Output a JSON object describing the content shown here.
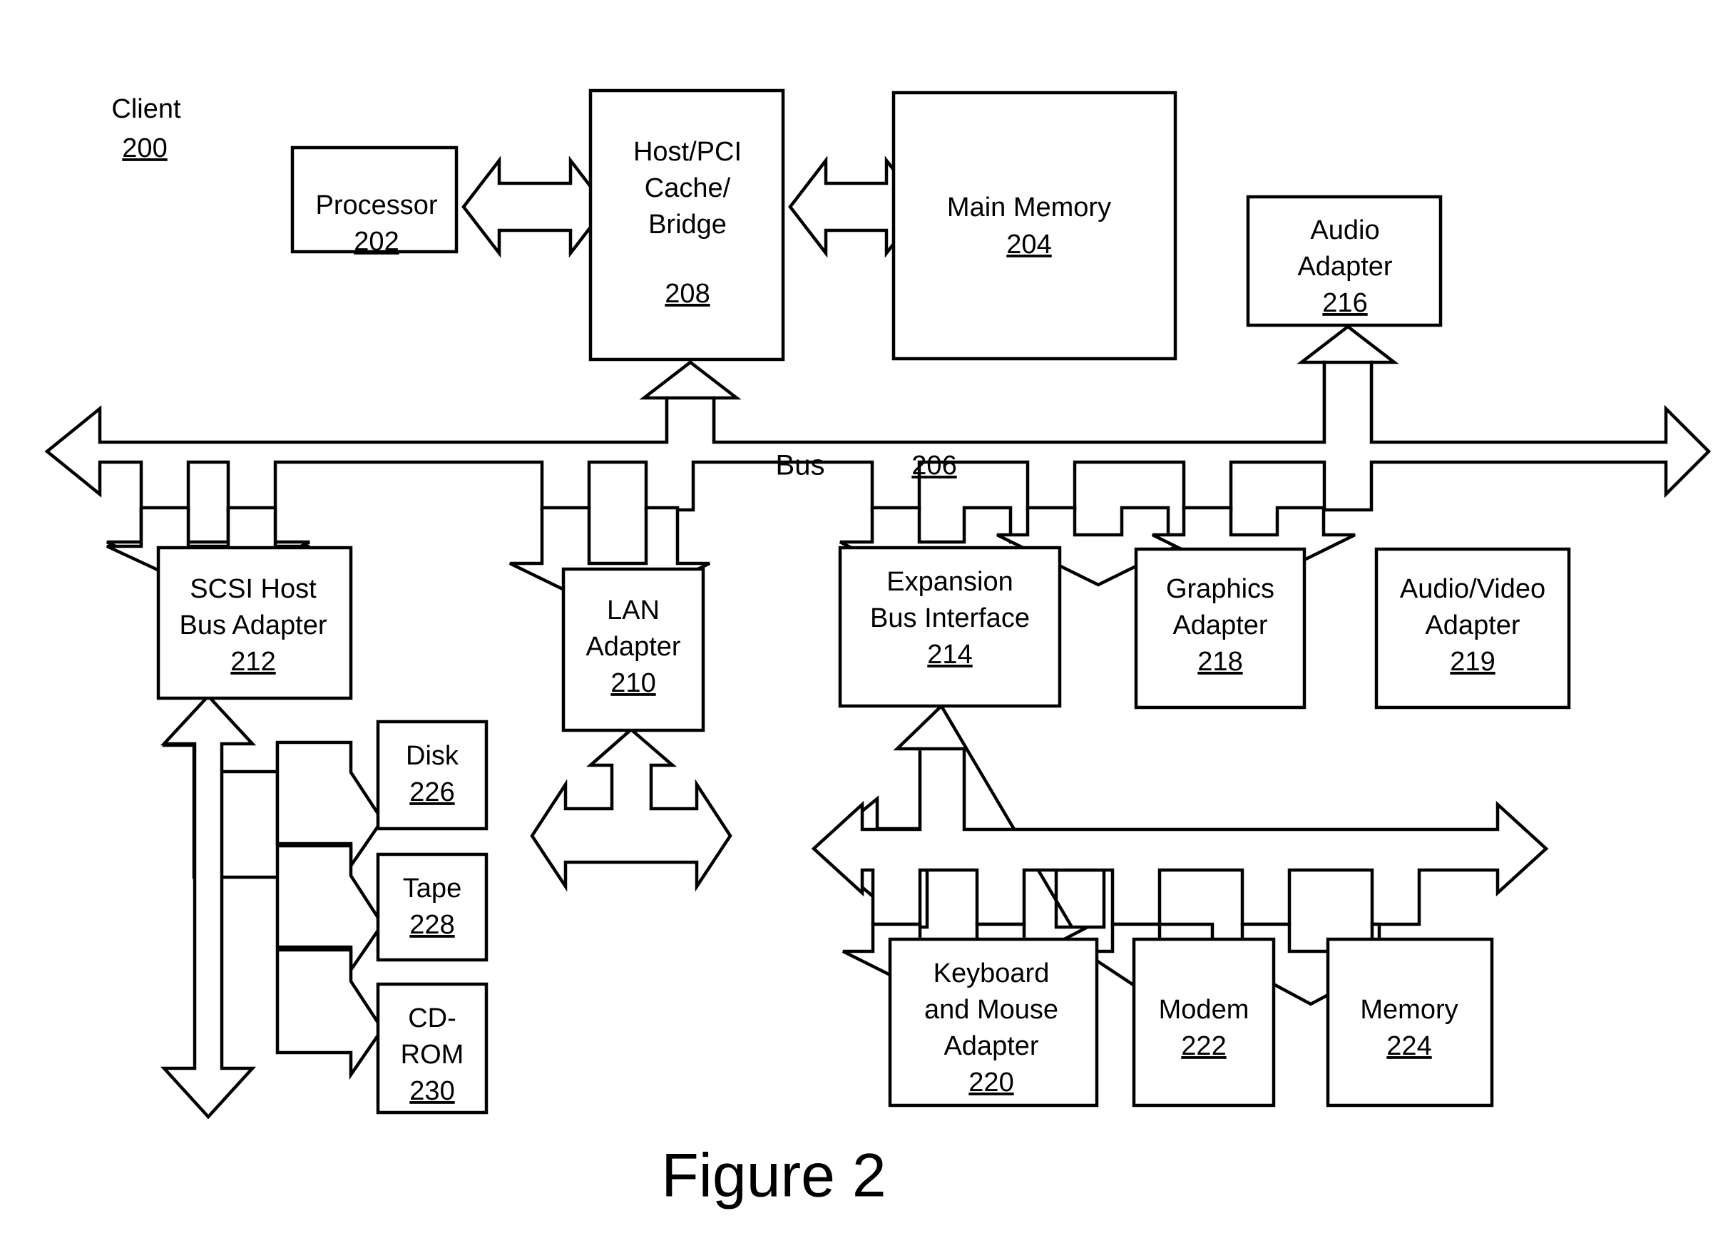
{
  "figure": {
    "caption": "Figure 2",
    "corner_label": "Client",
    "corner_ref": "200"
  },
  "bus": {
    "label": "Bus",
    "ref": "206"
  },
  "boxes": {
    "processor": {
      "lines": [
        "Processor"
      ],
      "ref": "202"
    },
    "host_bridge": {
      "lines": [
        "Host/PCI",
        "Cache/",
        "Bridge"
      ],
      "ref": "208"
    },
    "main_memory": {
      "lines": [
        "Main Memory"
      ],
      "ref": "204"
    },
    "audio_adapter": {
      "lines": [
        "Audio",
        "Adapter"
      ],
      "ref": "216"
    },
    "scsi_adapter": {
      "lines": [
        "SCSI Host",
        "Bus Adapter"
      ],
      "ref": "212"
    },
    "lan_adapter": {
      "lines": [
        "LAN",
        "Adapter"
      ],
      "ref": "210"
    },
    "expansion_bus": {
      "lines": [
        "Expansion",
        "Bus Interface"
      ],
      "ref": "214"
    },
    "graphics_adapter": {
      "lines": [
        "Graphics",
        "Adapter"
      ],
      "ref": "218"
    },
    "av_adapter": {
      "lines": [
        "Audio/Video",
        "Adapter"
      ],
      "ref": "219"
    },
    "disk": {
      "lines": [
        "Disk"
      ],
      "ref": "226"
    },
    "tape": {
      "lines": [
        "Tape"
      ],
      "ref": "228"
    },
    "cdrom": {
      "lines": [
        "CD-",
        "ROM"
      ],
      "ref": "230"
    },
    "keyboard_mouse": {
      "lines": [
        "Keyboard",
        "and Mouse",
        "Adapter"
      ],
      "ref": "220"
    },
    "modem": {
      "lines": [
        "Modem"
      ],
      "ref": "222"
    },
    "memory": {
      "lines": [
        "Memory"
      ],
      "ref": "224"
    }
  },
  "colors": {
    "stroke": "#000000",
    "fill": "#ffffff",
    "background": "#ffffff"
  },
  "chart_data": {
    "type": "diagram",
    "title": "Figure 2",
    "nodes": [
      {
        "id": "200",
        "label": "Client"
      },
      {
        "id": "202",
        "label": "Processor"
      },
      {
        "id": "208",
        "label": "Host/PCI Cache/Bridge"
      },
      {
        "id": "204",
        "label": "Main Memory"
      },
      {
        "id": "216",
        "label": "Audio Adapter"
      },
      {
        "id": "206",
        "label": "Bus"
      },
      {
        "id": "212",
        "label": "SCSI Host Bus Adapter"
      },
      {
        "id": "210",
        "label": "LAN Adapter"
      },
      {
        "id": "214",
        "label": "Expansion Bus Interface"
      },
      {
        "id": "218",
        "label": "Graphics Adapter"
      },
      {
        "id": "219",
        "label": "Audio/Video Adapter"
      },
      {
        "id": "226",
        "label": "Disk"
      },
      {
        "id": "228",
        "label": "Tape"
      },
      {
        "id": "230",
        "label": "CD-ROM"
      },
      {
        "id": "220",
        "label": "Keyboard and Mouse Adapter"
      },
      {
        "id": "222",
        "label": "Modem"
      },
      {
        "id": "224",
        "label": "Memory"
      }
    ],
    "edges": [
      {
        "from": "202",
        "to": "208",
        "kind": "bidirectional"
      },
      {
        "from": "208",
        "to": "204",
        "kind": "bidirectional"
      },
      {
        "from": "208",
        "to": "206",
        "kind": "bidirectional"
      },
      {
        "from": "206",
        "to": "216",
        "kind": "bidirectional"
      },
      {
        "from": "206",
        "to": "212",
        "kind": "bidirectional"
      },
      {
        "from": "206",
        "to": "210",
        "kind": "bidirectional"
      },
      {
        "from": "206",
        "to": "214",
        "kind": "bidirectional"
      },
      {
        "from": "206",
        "to": "218",
        "kind": "bidirectional"
      },
      {
        "from": "206",
        "to": "219",
        "kind": "bidirectional"
      },
      {
        "from": "212",
        "to": "226",
        "kind": "directed"
      },
      {
        "from": "212",
        "to": "228",
        "kind": "directed"
      },
      {
        "from": "212",
        "to": "230",
        "kind": "directed"
      },
      {
        "from": "214",
        "to": "220",
        "kind": "bidirectional"
      },
      {
        "from": "214",
        "to": "222",
        "kind": "bidirectional"
      },
      {
        "from": "214",
        "to": "224",
        "kind": "bidirectional"
      }
    ]
  }
}
